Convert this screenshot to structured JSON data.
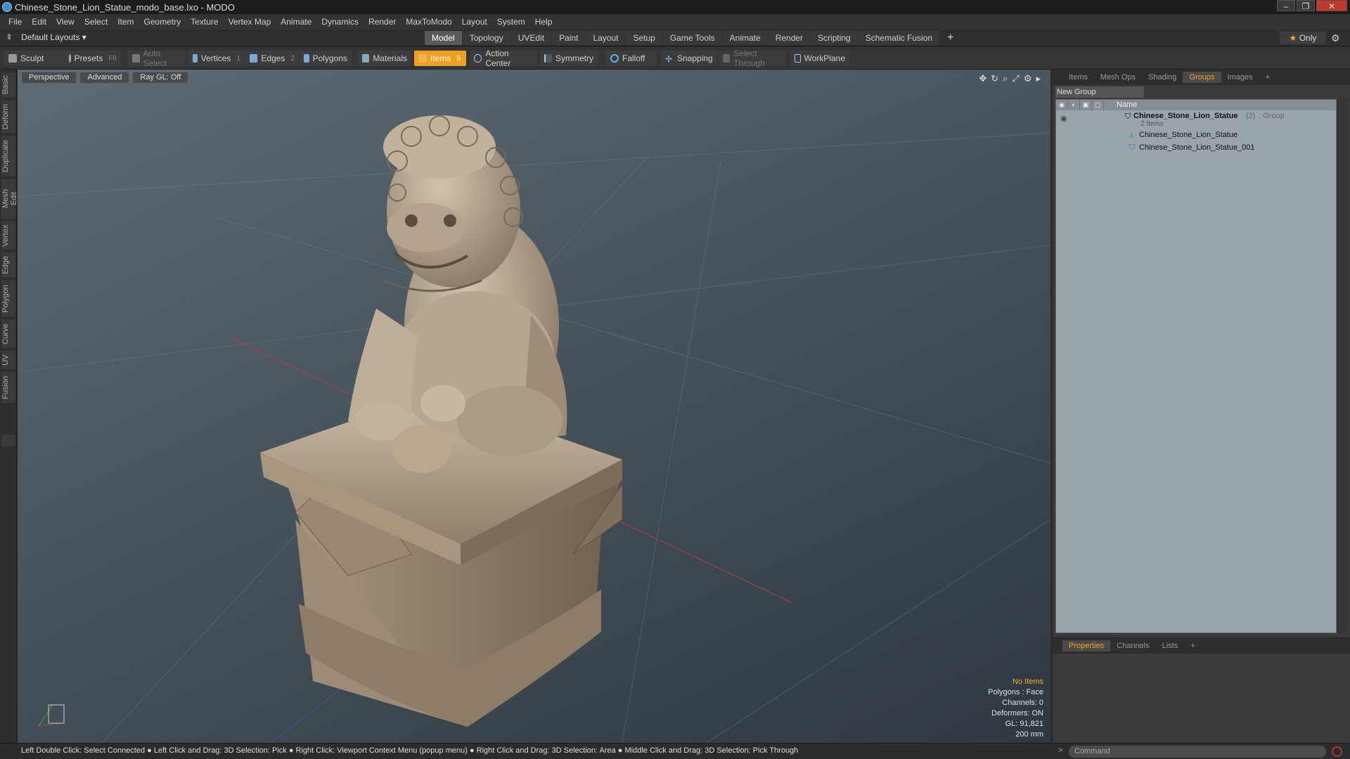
{
  "window": {
    "title": "Chinese_Stone_Lion_Statue_modo_base.lxo - MODO",
    "minimize": "–",
    "maximize": "❐",
    "close": "✕"
  },
  "menu": [
    "File",
    "Edit",
    "View",
    "Select",
    "Item",
    "Geometry",
    "Texture",
    "Vertex Map",
    "Animate",
    "Dynamics",
    "Render",
    "MaxToModo",
    "Layout",
    "System",
    "Help"
  ],
  "layouts": {
    "label": "Default Layouts ▾"
  },
  "modetabs": [
    "Model",
    "Topology",
    "UVEdit",
    "Paint",
    "Layout",
    "Setup",
    "Game Tools",
    "Animate",
    "Render",
    "Scripting",
    "Schematic Fusion"
  ],
  "modetabs_active": "Model",
  "only": {
    "star": "★",
    "label": "Only"
  },
  "toolbar": {
    "sculpt": "Sculpt",
    "presets": "Presets",
    "presets_key": "F6",
    "autoselect": "Auto Select",
    "vertices": "Vertices",
    "vertices_key": "1",
    "edges": "Edges",
    "edges_key": "2",
    "polygons": "Polygons",
    "materials": "Materials",
    "items": "Items",
    "items_key": "5",
    "actioncenter": "Action Center",
    "symmetry": "Symmetry",
    "falloff": "Falloff",
    "snapping": "Snapping",
    "selectthrough": "Select Through",
    "workplane": "WorkPlane"
  },
  "lefttabs": [
    "Basic",
    "Deform",
    "Duplicate",
    "Mesh Edit",
    "Vertex",
    "Edge",
    "Polygon",
    "Curve",
    "UV",
    "Fusion"
  ],
  "viewport": {
    "view": "Perspective",
    "shading": "Advanced",
    "raygl": "Ray GL: Off",
    "info": {
      "items": "No Items",
      "polygons": "Polygons : Face",
      "channels": "Channels: 0",
      "deformers": "Deformers: ON",
      "gl": "GL: 91,821",
      "scale": "200 mm"
    }
  },
  "rightpanel": {
    "tabs": [
      "Items",
      "Mesh Ops",
      "Shading",
      "Groups",
      "Images",
      "+"
    ],
    "active": "Groups",
    "newgroup": "New Group",
    "header_name": "Name",
    "group": {
      "name": "Chinese_Stone_Lion_Statue",
      "count": "(2)",
      "type": ": Group",
      "sub": "2 Items"
    },
    "children": [
      "Chinese_Stone_Lion_Statue",
      "Chinese_Stone_Lion_Statue_001"
    ]
  },
  "propspanel": {
    "tabs": [
      "Properties",
      "Channels",
      "Lists",
      "+"
    ],
    "active": "Properties"
  },
  "status": {
    "text": "Left Double Click: Select Connected ● Left Click and Drag: 3D Selection: Pick ● Right Click: Viewport Context Menu (popup menu) ● Right Click and Drag: 3D Selection: Area ● Middle Click and Drag: 3D Selection: Pick Through",
    "command_placeholder": "Command"
  },
  "colors": {
    "accent": "#f0a020",
    "viewport_bg": "#4a5660",
    "stone": "#b8a690"
  }
}
